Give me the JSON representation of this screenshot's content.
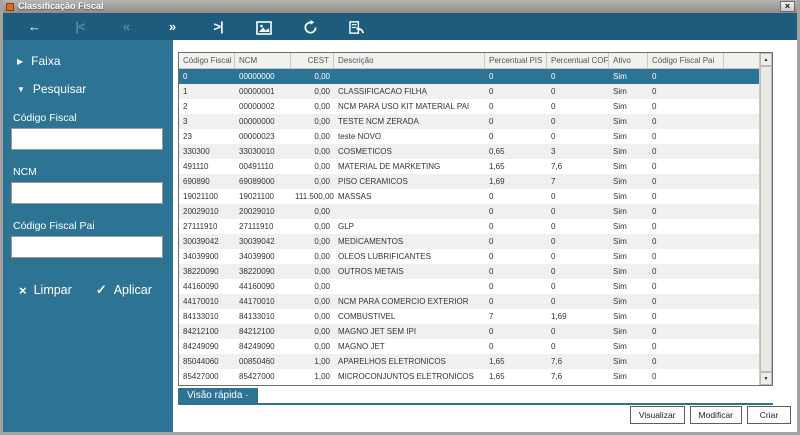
{
  "window": {
    "title": "Classificação Fiscal",
    "close_label": "×"
  },
  "colors": {
    "toolbar_bg": "#1E5C7D",
    "sidebar_bg": "#2D7394",
    "selection_bg": "#2D7394",
    "header_bg": "#F1F0EC",
    "alt_row_bg": "#F0F0EE",
    "accent_orange": "#E06A1F"
  },
  "toolbar": {
    "icons": [
      {
        "name": "back-icon",
        "glyph": "←",
        "enabled": true
      },
      {
        "name": "first-record-icon",
        "glyph": "|<",
        "enabled": false
      },
      {
        "name": "previous-record-icon",
        "glyph": "«",
        "enabled": false
      },
      {
        "name": "next-record-icon",
        "glyph": "»",
        "enabled": true
      },
      {
        "name": "last-record-icon",
        "glyph": ">|",
        "enabled": true
      },
      {
        "name": "preview-icon",
        "svg": "preview",
        "enabled": true
      },
      {
        "name": "refresh-icon",
        "svg": "refresh",
        "enabled": true
      },
      {
        "name": "revert-report-icon",
        "svg": "revert",
        "enabled": true
      }
    ]
  },
  "sidebar": {
    "collapsed_icon": "▶",
    "expanded_icon": "▼",
    "faixa_label": "Faixa",
    "pesquisar_label": "Pesquisar",
    "fields": [
      {
        "label": "Código Fiscal",
        "value": "",
        "placeholder": ""
      },
      {
        "label": "NCM",
        "value": "",
        "placeholder": ""
      },
      {
        "label": "Código Fiscal Pai",
        "value": "",
        "placeholder": ""
      }
    ],
    "limpar_icon": "×",
    "limpar_label": "Limpar",
    "aplicar_icon": "✓",
    "aplicar_label": "Aplicar"
  },
  "table": {
    "columns": [
      "Código Fiscal",
      "NCM",
      "CEST",
      "Descrição",
      "Percentual PIS",
      "Percentual COFINS",
      "Ativo",
      "Código Fiscal Pai"
    ],
    "selected_row_index": 0,
    "rows": [
      [
        "0",
        "00000000",
        "0,00",
        "",
        "0",
        "0",
        "Sim",
        "0"
      ],
      [
        "1",
        "00000001",
        "0,00",
        "CLASSIFICACAO FILHA",
        "0",
        "0",
        "Sim",
        "0"
      ],
      [
        "2",
        "00000002",
        "0,00",
        "NCM PARA USO KIT MATERIAL PAI",
        "0",
        "0",
        "Sim",
        "0"
      ],
      [
        "3",
        "00000000",
        "0,00",
        "TESTE NCM ZERADA",
        "0",
        "0",
        "Sim",
        "0"
      ],
      [
        "23",
        "00000023",
        "0,00",
        "teste NOVO",
        "0",
        "0",
        "Sim",
        "0"
      ],
      [
        "330300",
        "33030010",
        "0,00",
        "COSMETICOS",
        "0,65",
        "3",
        "Sim",
        "0"
      ],
      [
        "491110",
        "00491110",
        "0,00",
        "MATERIAL DE MARKETING",
        "1,65",
        "7,6",
        "Sim",
        "0"
      ],
      [
        "690890",
        "69089000",
        "0,00",
        "PISO CERAMICOS",
        "1,69",
        "7",
        "Sim",
        "0"
      ],
      [
        "19021100",
        "19021100",
        "111.500,00",
        "MASSAS",
        "0",
        "0",
        "Sim",
        "0"
      ],
      [
        "20029010",
        "20029010",
        "0,00",
        "",
        "0",
        "0",
        "Sim",
        "0"
      ],
      [
        "27111910",
        "27111910",
        "0,00",
        "GLP",
        "0",
        "0",
        "Sim",
        "0"
      ],
      [
        "30039042",
        "30039042",
        "0,00",
        "MEDICAMENTOS",
        "0",
        "0",
        "Sim",
        "0"
      ],
      [
        "34039900",
        "34039900",
        "0,00",
        "OLEOS LUBRIFICANTES",
        "0",
        "0",
        "Sim",
        "0"
      ],
      [
        "38220090",
        "38220090",
        "0,00",
        "OUTROS METAIS",
        "0",
        "0",
        "Sim",
        "0"
      ],
      [
        "44160090",
        "44160090",
        "0,00",
        "",
        "0",
        "0",
        "Sim",
        "0"
      ],
      [
        "44170010",
        "44170010",
        "0,00",
        "NCM PARA COMERCIO EXTERIOR",
        "0",
        "0",
        "Sim",
        "0"
      ],
      [
        "84133010",
        "84133010",
        "0,00",
        "COMBUSTIVEL",
        "7",
        "1,69",
        "Sim",
        "0"
      ],
      [
        "84212100",
        "84212100",
        "0,00",
        "MAGNO JET SEM IPI",
        "0",
        "0",
        "Sim",
        "0"
      ],
      [
        "84249090",
        "84249090",
        "0,00",
        "MAGNO JET",
        "0",
        "0",
        "Sim",
        "0"
      ],
      [
        "85044060",
        "00850460",
        "1,00",
        "APARELHOS ELETRONICOS",
        "1,65",
        "7,6",
        "Sim",
        "0"
      ],
      [
        "85427000",
        "85427000",
        "1,00",
        "MICROCONJUNTOS ELETRONICOS",
        "1,65",
        "7,6",
        "Sim",
        "0"
      ]
    ],
    "scrollbar": {
      "up_icon": "▲",
      "down_icon": "▼"
    }
  },
  "footer": {
    "quick_view_tab": "Visão rápida ·",
    "buttons": [
      {
        "name": "visualizar-button",
        "label": "Visualizar"
      },
      {
        "name": "modificar-button",
        "label": "Modificar"
      },
      {
        "name": "criar-button",
        "label": "Criar"
      }
    ]
  }
}
